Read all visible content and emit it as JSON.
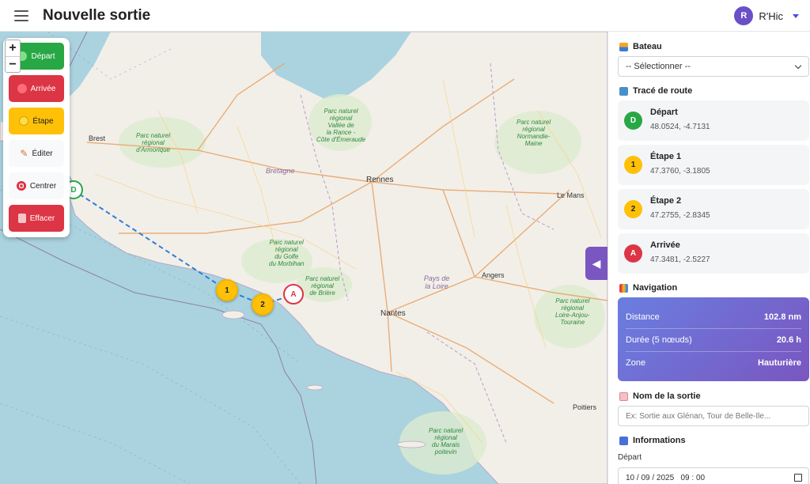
{
  "header": {
    "title": "Nouvelle sortie",
    "user_initial": "R",
    "user_name": "R'Hic"
  },
  "zoom": {
    "plus": "+",
    "minus": "−"
  },
  "tools": {
    "depart": "Départ",
    "arrivee": "Arrivée",
    "etape": "Étape",
    "editer": "Éditer",
    "centrer": "Centrer",
    "effacer": "Effacer"
  },
  "map": {
    "cities": [
      "Brest",
      "Rennes",
      "Nantes",
      "Angers",
      "Le Mans",
      "Poitiers"
    ],
    "regions": [
      "Bretagne",
      "Pays de la Loire"
    ],
    "parks": [
      "Parc naturel\nrégional\nd'Armorique",
      "Parc naturel\nrégional\nVallée de\nla Rance -\nCôte d'Émeraude",
      "Parc naturel\nrégional\nNormandie-\nMaine",
      "Parc naturel\nrégional\ndu Golfe\ndu Morbihan",
      "Parc naturel\nrégional\nde Brière",
      "Parc naturel\nrégional\nLoire-Anjou-\nTouraine",
      "Parc naturel\nrégional\ndu Marais\npoitevin"
    ],
    "markers": {
      "depart": "D",
      "step1": "1",
      "step2": "2",
      "arrivee": "A"
    }
  },
  "sidebar": {
    "boat": {
      "title": "Bateau",
      "select_value": "-- Sélectionner --"
    },
    "route": {
      "title": "Tracé de route",
      "waypoints": [
        {
          "badge": "D",
          "name": "Départ",
          "coords": "48.0524, -4.7131",
          "color": "#28a745"
        },
        {
          "badge": "1",
          "name": "Étape 1",
          "coords": "47.3760, -3.1805",
          "color": "#ffc107"
        },
        {
          "badge": "2",
          "name": "Étape 2",
          "coords": "47.2755, -2.8345",
          "color": "#ffc107"
        },
        {
          "badge": "A",
          "name": "Arrivée",
          "coords": "47.3481, -2.5227",
          "color": "#dc3545"
        }
      ]
    },
    "navigation": {
      "title": "Navigation",
      "rows": [
        {
          "label": "Distance",
          "value": "102.8 nm"
        },
        {
          "label": "Durée (5 nœuds)",
          "value": "20.6 h"
        },
        {
          "label": "Zone",
          "value": "Hauturière"
        }
      ]
    },
    "name": {
      "title": "Nom de la sortie",
      "placeholder": "Ex: Sortie aux Glénan, Tour de Belle-Île..."
    },
    "info": {
      "title": "Informations",
      "depart_label": "Départ",
      "depart_value": "10 / 09 / 2025   09 : 00"
    },
    "collapse": "◀"
  },
  "colors": {
    "accent": "#7a56c0",
    "success": "#28a745",
    "danger": "#dc3545",
    "warning": "#ffc107"
  }
}
